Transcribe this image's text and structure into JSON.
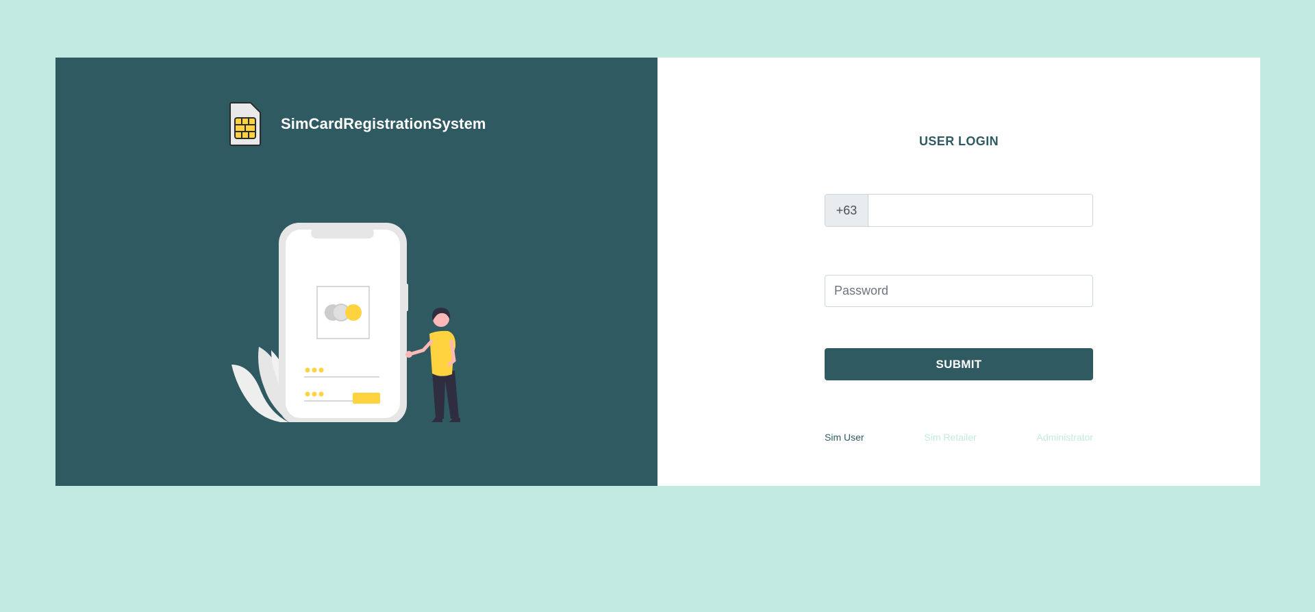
{
  "brand": {
    "name": "SimCardRegistrationSystem",
    "logo_icon": "sim-card-icon"
  },
  "colors": {
    "page_background": "#c2eae1",
    "panel_dark": "#305a62",
    "accent_yellow": "#ffd23f",
    "white": "#ffffff"
  },
  "login": {
    "title": "USER LOGIN",
    "phone_prefix": "+63",
    "phone_value": "",
    "password_placeholder": "Password",
    "submit_label": "SUBMIT"
  },
  "roles": [
    {
      "label": "Sim User",
      "active": true
    },
    {
      "label": "Sim Retailer",
      "active": false
    },
    {
      "label": "Administrator",
      "active": false
    }
  ]
}
